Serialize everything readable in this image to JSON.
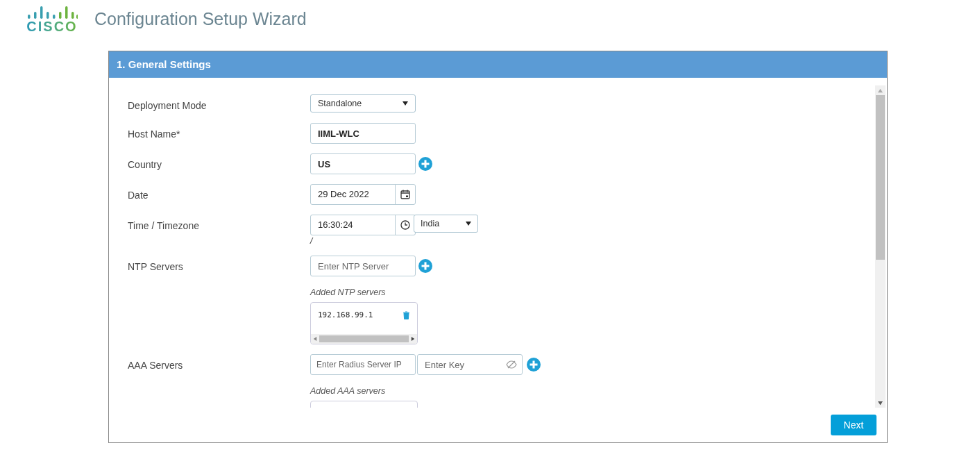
{
  "logo": {
    "text": "CISCO"
  },
  "title": "Configuration Setup Wizard",
  "panel": {
    "title": "1. General Settings"
  },
  "fields": [
    {
      "label": "Deployment Mode",
      "kind": "select",
      "value": "Standalone"
    },
    {
      "label": "Host Name*",
      "kind": "text",
      "value": "IIML-WLC"
    },
    {
      "label": "Country",
      "kind": "text_add",
      "value": "US"
    },
    {
      "label": "Date",
      "kind": "date",
      "value": "29 Dec 2022"
    },
    {
      "label": "Time / Timezone",
      "kind": "time",
      "value": "16:30:24",
      "timezone": "India",
      "note": "/"
    },
    {
      "label": "NTP Servers",
      "kind": "list_add",
      "placeholder": "Enter NTP Server",
      "list_title": "Added NTP servers",
      "entries": [
        "192.168.99.1"
      ]
    },
    {
      "label": "AAA Servers",
      "kind": "radius",
      "placeholder": "Enter Radius Server IP",
      "key_placeholder": "Enter Key",
      "list_title": "Added AAA servers"
    }
  ],
  "buttons": {
    "next": "Next"
  }
}
